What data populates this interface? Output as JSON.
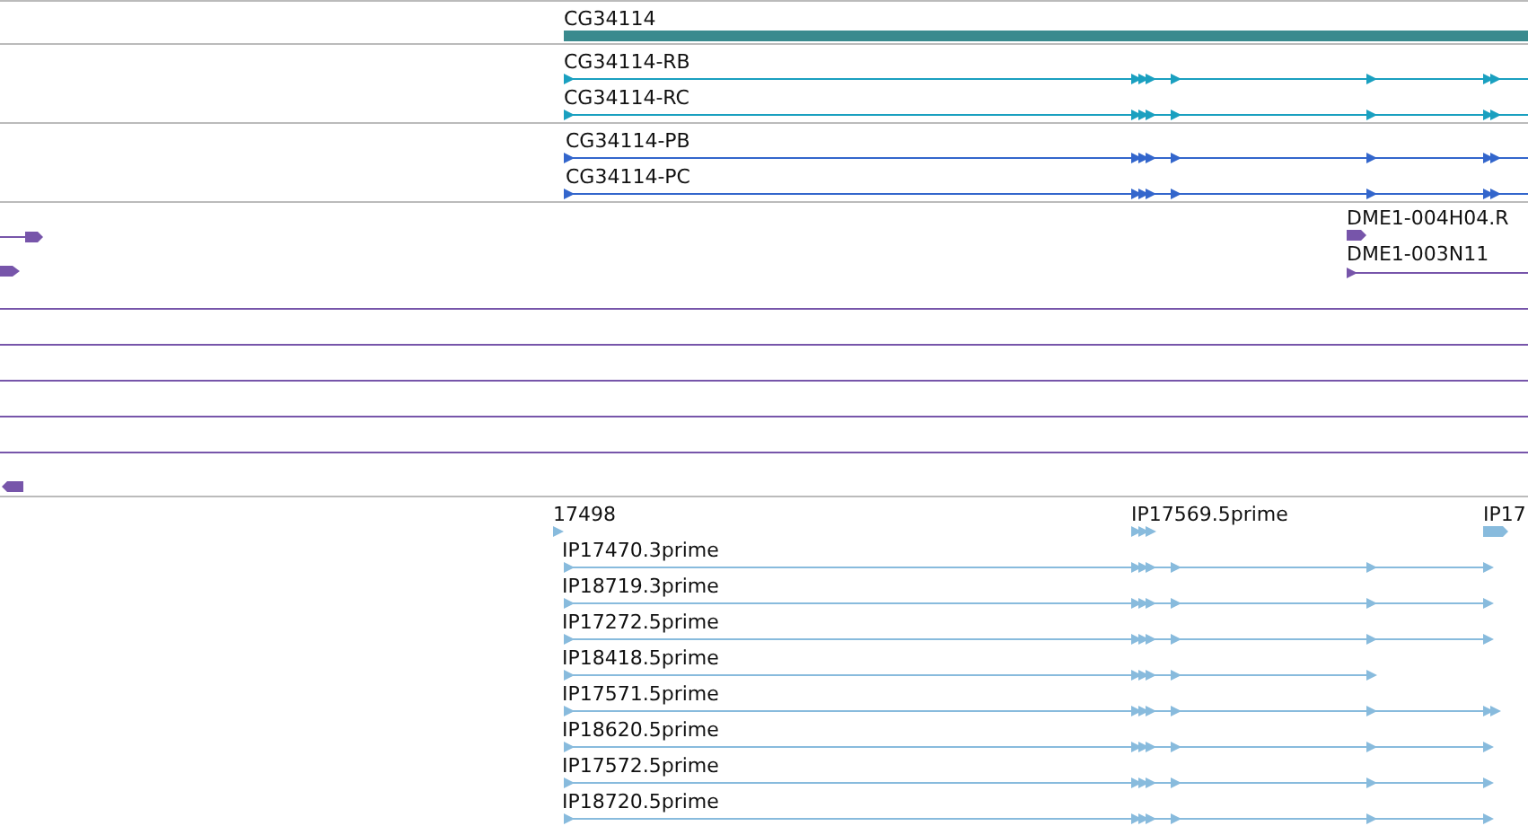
{
  "tracks": [
    {
      "kind": "gene",
      "color": "#3a8a8e",
      "features": [
        {
          "label": "CG34114"
        }
      ]
    },
    {
      "kind": "transcript",
      "color": "#1aa0c0",
      "features": [
        {
          "label": "CG34114-RB"
        },
        {
          "label": "CG34114-RC"
        }
      ]
    },
    {
      "kind": "transcript",
      "color": "#3366cc",
      "features": [
        {
          "label": "CG34114-PB"
        },
        {
          "label": "CG34114-PC"
        }
      ]
    },
    {
      "kind": "alignment",
      "color": "#7755aa",
      "features": [
        {
          "label": "DME1-004H04.R"
        },
        {
          "label": "DME1-003N11"
        }
      ]
    },
    {
      "kind": "alignment",
      "color": "#88bbdd",
      "features": [
        {
          "label": "17498"
        },
        {
          "label": "IP17569.5prime"
        },
        {
          "label": "IP17"
        },
        {
          "label": "IP17470.3prime"
        },
        {
          "label": "IP18719.3prime"
        },
        {
          "label": "IP17272.5prime"
        },
        {
          "label": "IP18418.5prime"
        },
        {
          "label": "IP17571.5prime"
        },
        {
          "label": "IP18620.5prime"
        },
        {
          "label": "IP17572.5prime"
        },
        {
          "label": "IP18720.5prime"
        }
      ]
    }
  ]
}
